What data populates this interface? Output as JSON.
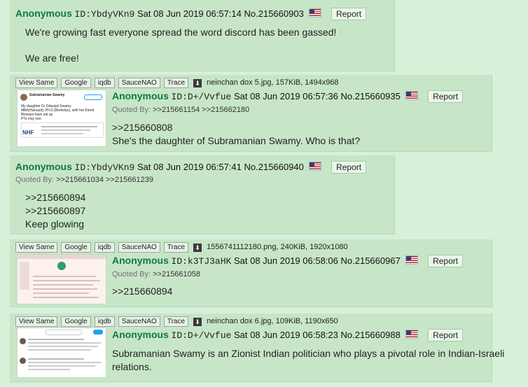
{
  "report_label": "Report",
  "quoted_by_label": "Quoted By:",
  "toolbar_buttons": [
    "View Same",
    "Google",
    "iqdb",
    "SauceNAO",
    "Trace"
  ],
  "download_icon": "download-icon",
  "flag_colors": {
    "stripe": "#b22234",
    "field": "#3c3b6e"
  },
  "posts": [
    {
      "name": "Anonymous",
      "uid": "ID:YbdyVKn9",
      "date": "Sat 08 Jun 2019 06:57:14",
      "no": "No.215660903",
      "lines": [
        "We're growing fast everyone spread the word discord has been gassed!",
        "",
        "We are free!"
      ]
    },
    {
      "name": "Anonymous",
      "uid": "ID:D+/Vvfue",
      "date": "Sat 08 Jun 2019 06:57:36",
      "no": "No.215660935",
      "file": "neinchan dox 5.jpg, 157KiB, 1494x968",
      "quoted_by": [
        ">>215661154",
        ">>215662180"
      ],
      "lines": [
        ">>215660808",
        "She's the daughter of Subramanian Swamy. Who is that?"
      ],
      "thumb_text": {
        "head": "Subramanian Swamy",
        "l1": "My daughter Dr Gitanjali Swamy",
        "l2": "MBA(Harvard), Ph.D.(Berkeley), with her friend",
        "l3": "Bhavani have set up",
        "l4": "PTs may see.",
        "logo": "NHF"
      }
    },
    {
      "name": "Anonymous",
      "uid": "ID:YbdyVKn9",
      "date": "Sat 08 Jun 2019 06:57:41",
      "no": "No.215660940",
      "quoted_by": [
        ">>215661034",
        ">>215661239"
      ],
      "lines": [
        ">>215660894",
        ">>215660897",
        "Keep glowing"
      ]
    },
    {
      "name": "Anonymous",
      "uid": "ID:k3TJ3aHK",
      "date": "Sat 08 Jun 2019 06:58:06",
      "no": "No.215660967",
      "file": "1556741112180.png, 240KiB, 1920x1080",
      "quoted_by": [
        ">>215661058"
      ],
      "lines": [
        ">>215660894"
      ]
    },
    {
      "name": "Anonymous",
      "uid": "ID:D+/Vvfue",
      "date": "Sat 08 Jun 2019 06:58:23",
      "no": "No.215660988",
      "file": "neinchan dox 6.jpg, 109KiB, 1190x650",
      "lines": [
        "Subramanian Swamy is an Zionist Indian politician who plays a pivotal role in Indian-Israeli",
        "relations."
      ]
    }
  ]
}
